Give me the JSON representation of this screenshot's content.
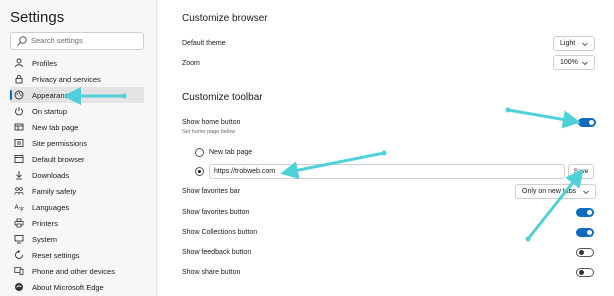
{
  "sidebar": {
    "title": "Settings",
    "search_placeholder": "Search settings",
    "items": [
      {
        "label": "Profiles",
        "icon": "profile-icon"
      },
      {
        "label": "Privacy and services",
        "icon": "lock-icon"
      },
      {
        "label": "Appearance",
        "icon": "palette-icon",
        "active": true
      },
      {
        "label": "On startup",
        "icon": "power-icon"
      },
      {
        "label": "New tab page",
        "icon": "grid-icon"
      },
      {
        "label": "Site permissions",
        "icon": "sliders-icon"
      },
      {
        "label": "Default browser",
        "icon": "browser-icon"
      },
      {
        "label": "Downloads",
        "icon": "download-icon"
      },
      {
        "label": "Family safety",
        "icon": "family-icon"
      },
      {
        "label": "Languages",
        "icon": "language-icon"
      },
      {
        "label": "Printers",
        "icon": "printer-icon"
      },
      {
        "label": "System",
        "icon": "monitor-icon"
      },
      {
        "label": "Reset settings",
        "icon": "reset-icon"
      },
      {
        "label": "Phone and other devices",
        "icon": "phone-icon"
      },
      {
        "label": "About Microsoft Edge",
        "icon": "edge-icon"
      }
    ]
  },
  "browser": {
    "heading": "Customize browser",
    "theme_label": "Default theme",
    "theme_value": "Light",
    "zoom_label": "Zoom",
    "zoom_value": "100%"
  },
  "toolbar": {
    "heading": "Customize toolbar",
    "home_label": "Show home button",
    "home_sublabel": "Set home page below",
    "home_on": true,
    "radio_newtab": "New tab page",
    "url_value": "https://trobweb.com",
    "save_label": "Save",
    "favbar_label": "Show favorites bar",
    "favbar_value": "Only on new tabs",
    "fav_button_label": "Show favorites button",
    "fav_button_on": true,
    "collections_label": "Show Collections button",
    "collections_on": true,
    "feedback_label": "Show feedback button",
    "feedback_on": false,
    "share_label": "Show share button",
    "share_on": false
  },
  "colors": {
    "accent": "#0f6cbd",
    "annotation": "#4fd1d9"
  }
}
